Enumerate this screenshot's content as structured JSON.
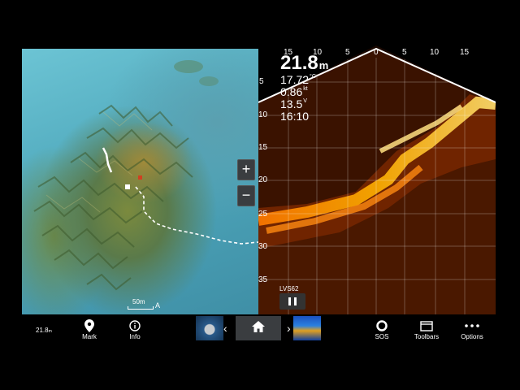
{
  "map": {
    "scale_label": "50m",
    "north_label": "A",
    "zoom_in_label": "+",
    "zoom_out_label": "−"
  },
  "sonar": {
    "range_ticks": [
      "15",
      "10",
      "5",
      "0",
      "5",
      "10",
      "15"
    ],
    "depth_ticks": [
      "5",
      "10",
      "15",
      "20",
      "25",
      "30",
      "35"
    ],
    "depth_value": "21.8",
    "depth_unit": "m",
    "temperature_value": "17.72",
    "temperature_unit": "°C",
    "speed_value": "0.86",
    "speed_unit": "kt",
    "voltage_value": "13.5",
    "voltage_unit": "V",
    "time": "16:10",
    "transducer_label": "LVS62"
  },
  "bottom_bar": {
    "depth_value": "21.8",
    "depth_unit": "m",
    "mark_label": "Mark",
    "info_label": "Info",
    "sos_label": "SOS",
    "toolbars_label": "Toolbars",
    "options_label": "Options"
  },
  "icons": {
    "mark": "map-pin-icon",
    "info": "info-icon",
    "home": "home-icon",
    "sos": "lifebuoy-icon",
    "toolbars": "window-icon",
    "options": "more-icon"
  }
}
